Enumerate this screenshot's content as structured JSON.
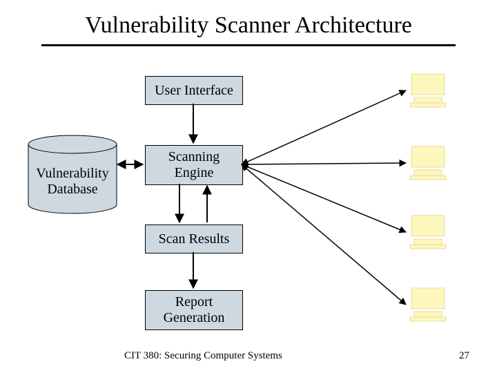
{
  "title": "Vulnerability Scanner Architecture",
  "nodes": {
    "ui": "User Interface",
    "engine": "Scanning\nEngine",
    "results": "Scan Results",
    "report": "Report\nGeneration",
    "db": "Vulnerability\nDatabase"
  },
  "footer_course": "CIT 380: Securing Computer Systems",
  "footer_page": "27"
}
